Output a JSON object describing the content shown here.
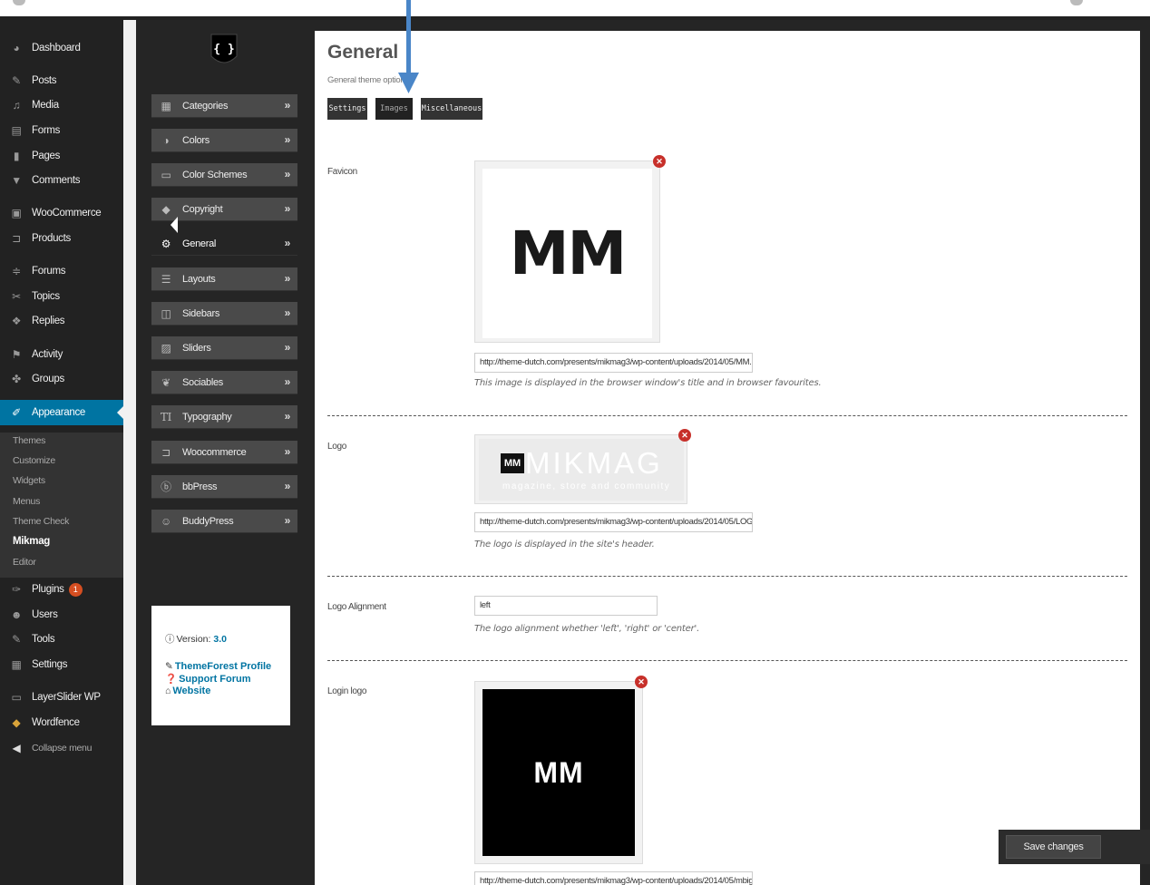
{
  "wp_menu": {
    "items": [
      {
        "label": "Dashboard",
        "icon": "dashboard-icon"
      },
      {
        "label": "Posts",
        "icon": "pin-icon"
      },
      {
        "label": "Media",
        "icon": "media-icon"
      },
      {
        "label": "Forms",
        "icon": "forms-icon"
      },
      {
        "label": "Pages",
        "icon": "pages-icon"
      },
      {
        "label": "Comments",
        "icon": "comments-icon"
      },
      {
        "label": "WooCommerce",
        "icon": "woocommerce-icon"
      },
      {
        "label": "Products",
        "icon": "cart-icon"
      },
      {
        "label": "Forums",
        "icon": "forums-icon"
      },
      {
        "label": "Topics",
        "icon": "topics-icon"
      },
      {
        "label": "Replies",
        "icon": "replies-icon"
      },
      {
        "label": "Activity",
        "icon": "activity-icon"
      },
      {
        "label": "Groups",
        "icon": "groups-icon"
      },
      {
        "label": "Appearance",
        "icon": "brush-icon"
      },
      {
        "label": "Plugins",
        "icon": "plugin-icon",
        "badge": "1"
      },
      {
        "label": "Users",
        "icon": "user-icon"
      },
      {
        "label": "Tools",
        "icon": "wrench-icon"
      },
      {
        "label": "Settings",
        "icon": "settings-icon"
      },
      {
        "label": "LayerSlider WP",
        "icon": "layerslider-icon"
      },
      {
        "label": "Wordfence",
        "icon": "wordfence-icon"
      },
      {
        "label": "Collapse menu",
        "icon": "collapse-icon"
      }
    ],
    "submenu": [
      "Themes",
      "Customize",
      "Widgets",
      "Menus",
      "Theme Check",
      "Mikmag",
      "Editor"
    ]
  },
  "options_nav": {
    "logo": "{ }",
    "items": [
      {
        "label": "Categories",
        "icon": "grid-icon"
      },
      {
        "label": "Colors",
        "icon": "contrast-icon"
      },
      {
        "label": "Color Schemes",
        "icon": "monitor-icon"
      },
      {
        "label": "Copyright",
        "icon": "tag-icon"
      },
      {
        "label": "General",
        "icon": "cogs-icon"
      },
      {
        "label": "Layouts",
        "icon": "list-icon"
      },
      {
        "label": "Sidebars",
        "icon": "columns-icon"
      },
      {
        "label": "Sliders",
        "icon": "image-icon"
      },
      {
        "label": "Sociables",
        "icon": "twitter-icon"
      },
      {
        "label": "Typography",
        "icon": "text-icon"
      },
      {
        "label": "Woocommerce",
        "icon": "cart-icon"
      },
      {
        "label": "bbPress",
        "icon": "bbpress-icon"
      },
      {
        "label": "BuddyPress",
        "icon": "buddypress-icon"
      }
    ],
    "chevron": "»",
    "info": {
      "version_label": "Version:",
      "version": "3.0",
      "themeforest": "ThemeForest Profile",
      "support": "Support Forum",
      "website": "Website"
    }
  },
  "main": {
    "title": "General",
    "subtitle": "General theme options",
    "tabs": [
      "Settings",
      "Images",
      "Miscellaneous"
    ],
    "fields": {
      "favicon": {
        "label": "Favicon",
        "image_text": "MM",
        "url": "http://theme-dutch.com/presents/mikmag3/wp-content/uploads/2014/05/MM.",
        "help": "This image is displayed in the browser window's title and in browser favourites."
      },
      "logo": {
        "label": "Logo",
        "image_mark": "MM",
        "image_brand": "MIKMAG",
        "image_tagline": "magazine, store and community",
        "url": "http://theme-dutch.com/presents/mikmag3/wp-content/uploads/2014/05/LOG(",
        "help": "The logo is displayed in the site's header."
      },
      "logo_alignment": {
        "label": "Logo Alignment",
        "value": "left",
        "help": "The logo alignment whether 'left', 'right' or 'center'."
      },
      "login_logo": {
        "label": "Login logo",
        "image_text": "MM",
        "url": "http://theme-dutch.com/presents/mikmag3/wp-content/uploads/2014/05/mbig"
      }
    },
    "remove_glyph": "✕",
    "save_label": "Save changes"
  },
  "colors": {
    "wp_active": "#0074a2",
    "annotation_arrow": "#4a86c8",
    "remove_red": "#c7302a"
  }
}
